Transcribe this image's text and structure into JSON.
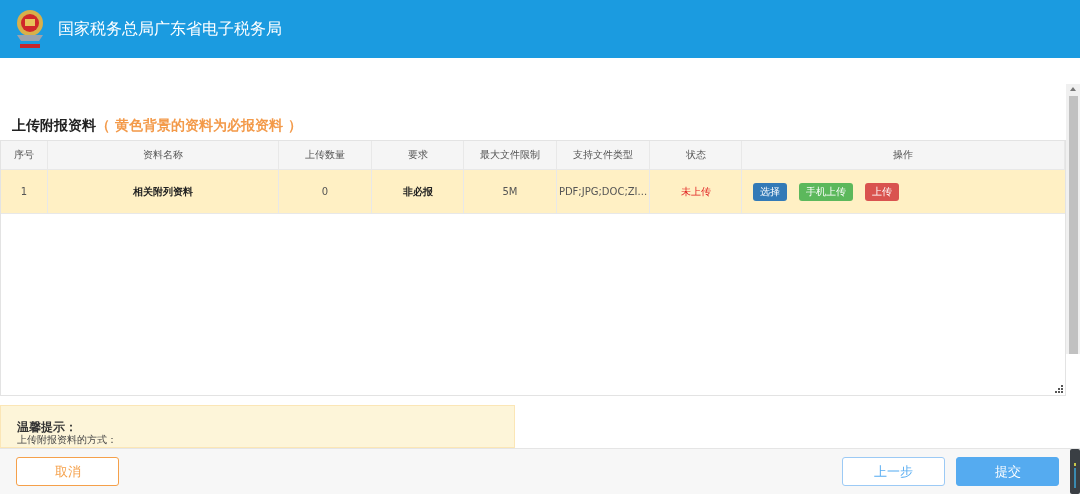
{
  "header": {
    "title": "国家税务总局广东省电子税务局"
  },
  "section": {
    "title": "上传附报资料",
    "note": "（ 黄色背景的资料为必报资料 ）"
  },
  "table": {
    "columns": [
      "序号",
      "资料名称",
      "上传数量",
      "要求",
      "最大文件限制",
      "支持文件类型",
      "状态",
      "操作"
    ],
    "rows": [
      {
        "required_highlight": true,
        "cells": [
          "1",
          "相关附列资料",
          "0",
          "非必报",
          "5M",
          "PDF;JPG;DOC;ZI..."
        ],
        "status": {
          "text": "未上传",
          "kind": "pending"
        },
        "actions": [
          {
            "label": "选择",
            "kind": "primary"
          },
          {
            "label": "手机上传",
            "kind": "success"
          },
          {
            "label": "上传",
            "kind": "danger"
          }
        ]
      }
    ]
  },
  "tip": {
    "title": "温馨提示：",
    "text": "上传附报资料的方式："
  },
  "footer": {
    "buttons": [
      {
        "label": "取消",
        "kind": "cancel"
      },
      {
        "label": "上一步",
        "kind": "back"
      },
      {
        "label": "提交",
        "kind": "submit"
      }
    ]
  }
}
